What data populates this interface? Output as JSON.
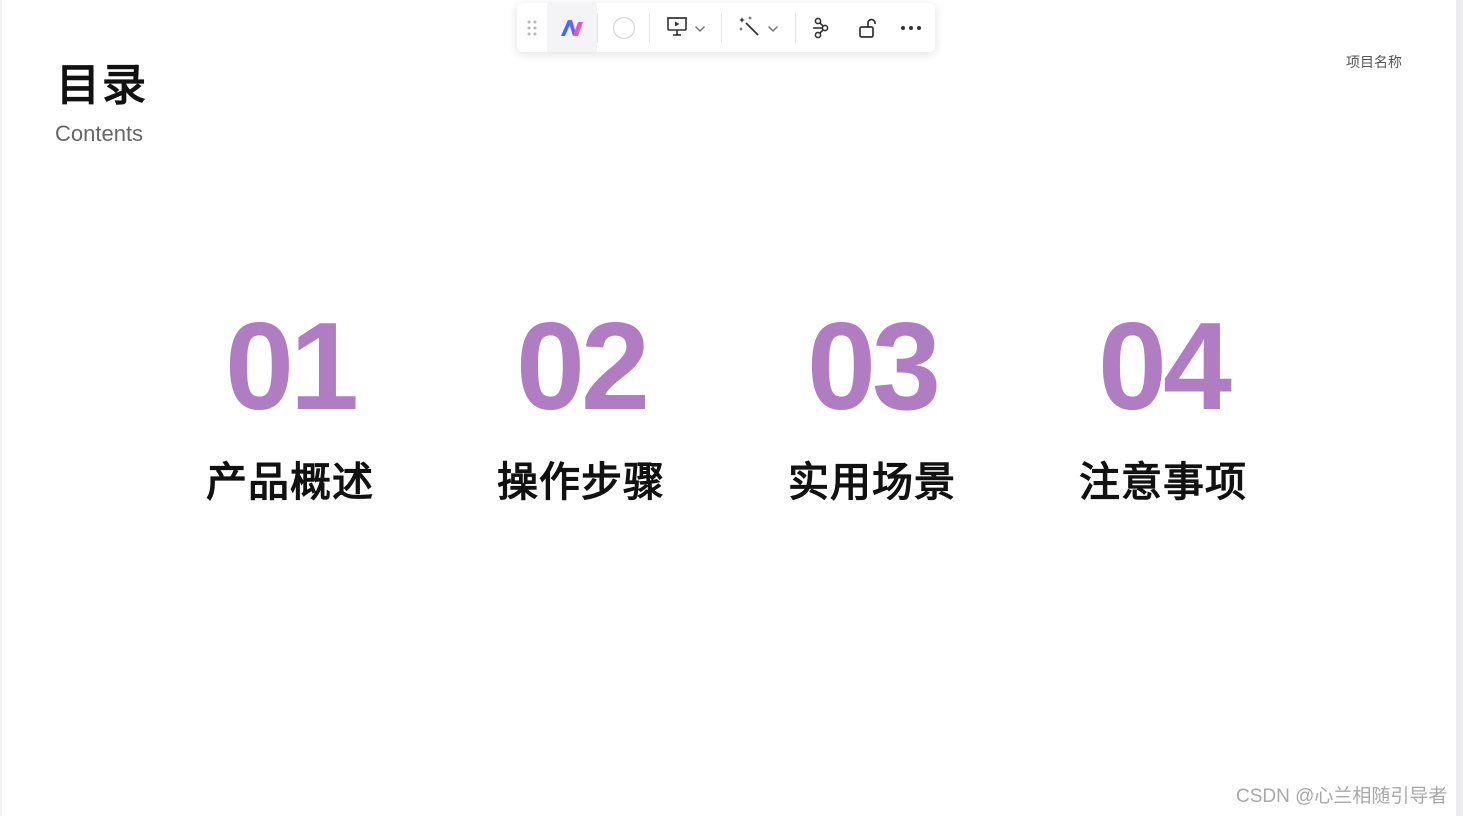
{
  "slide": {
    "title": "目录",
    "subtitle": "Contents",
    "project_name": "项目名称",
    "items": [
      {
        "number": "01",
        "label": "产品概述"
      },
      {
        "number": "02",
        "label": "操作步骤"
      },
      {
        "number": "03",
        "label": "实用场景"
      },
      {
        "number": "04",
        "label": "注意事项"
      }
    ]
  },
  "toolbar": {
    "icons": [
      "drag-handle-icon",
      "ai-logo-icon",
      "color-circle-icon",
      "presentation-icon",
      "chevron-down-icon",
      "magic-wand-icon",
      "chevron-down-icon",
      "share-nodes-icon",
      "unlock-icon",
      "more-icon"
    ]
  },
  "watermark": "CSDN @心兰相随引导者",
  "colors": {
    "accent": "#b07cc2",
    "text": "#111111",
    "subtitle": "#666666"
  }
}
